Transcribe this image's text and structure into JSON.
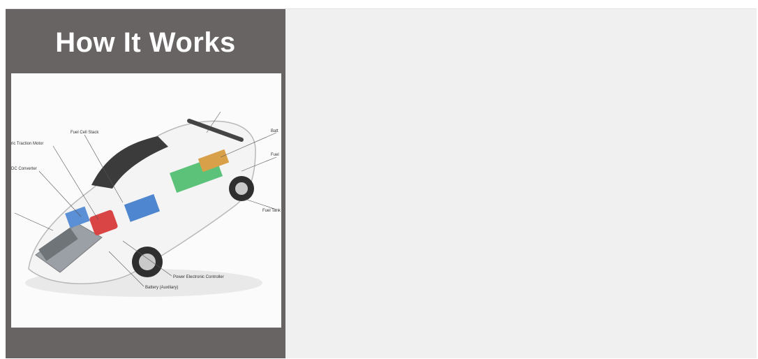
{
  "panel": {
    "title": "How It Works",
    "illustration": {
      "icon": "fuel-cell-car-cutaway-illustration",
      "callouts": [
        "Fuel Cell Stack",
        "ric Traction Motor",
        "DC Converter",
        "Power Electronic Controller",
        "Battery (Auxiliary)",
        "Batt",
        "Fuel",
        "Fuel Tank"
      ]
    }
  },
  "colors": {
    "panel_bg": "#696464",
    "page_bg": "#f0f0f0",
    "title_color": "#ffffff"
  }
}
